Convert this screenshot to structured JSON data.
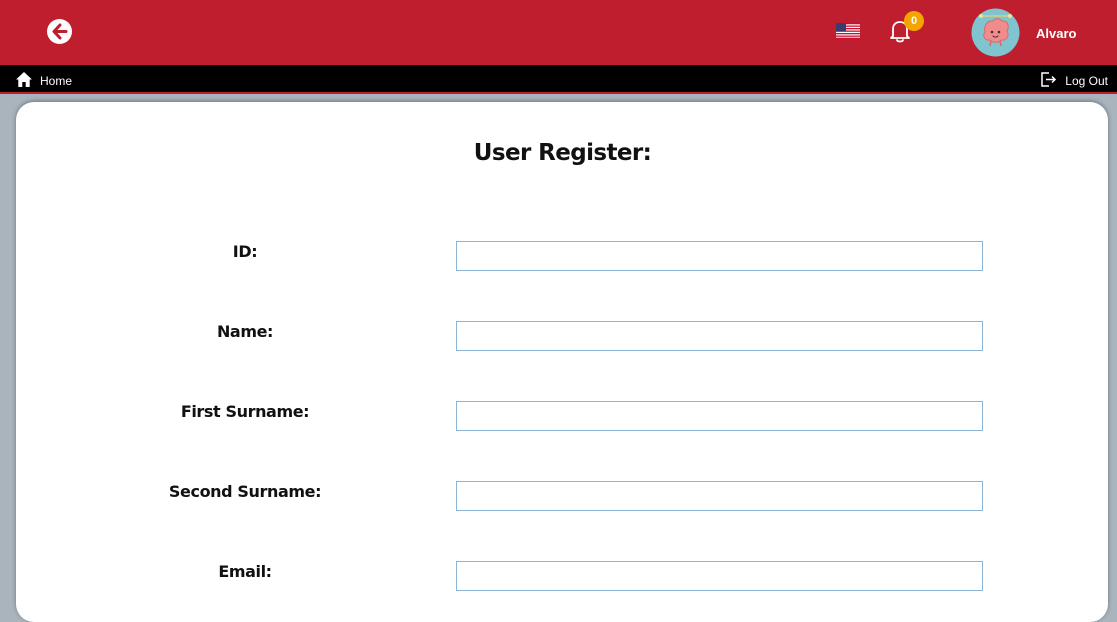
{
  "header": {
    "language_icon": "us-flag-icon",
    "notifications_count": "0",
    "user_name": "Alvaro"
  },
  "nav": {
    "home_label": "Home",
    "logout_label": "Log Out"
  },
  "form": {
    "title": "User Register:",
    "fields": [
      {
        "label": "ID:",
        "value": ""
      },
      {
        "label": "Name:",
        "value": ""
      },
      {
        "label": "First Surname:",
        "value": ""
      },
      {
        "label": "Second Surname:",
        "value": ""
      },
      {
        "label": "Email:",
        "value": ""
      }
    ]
  },
  "colors": {
    "brand_red": "#be1e2d",
    "badge_orange": "#f5a500",
    "nav_black": "#000000",
    "input_border": "#8ab4d6"
  }
}
